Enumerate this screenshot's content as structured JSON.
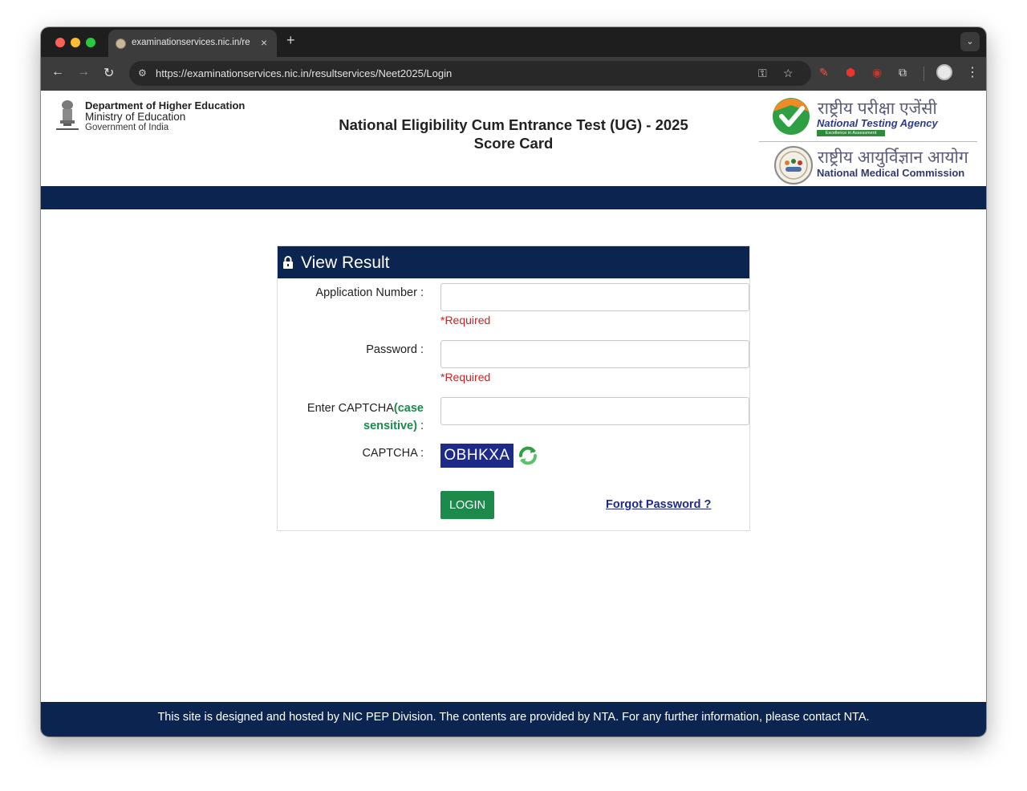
{
  "browser": {
    "tab_title": "examinationservices.nic.in/re",
    "tab_close": "×",
    "new_tab": "+",
    "url": "https://examinationservices.nic.in/resultservices/Neet2025/Login"
  },
  "header": {
    "dept": "Department of Higher Education",
    "ministry": "Ministry of Education",
    "govt": "Government of India",
    "title_line1": "National Eligibility Cum Entrance Test (UG) - 2025",
    "title_line2": "Score Card",
    "nta_hindi": "राष्ट्रीय परीक्षा एजेंसी",
    "nta_english": "National Testing Agency",
    "nta_tagline": "Excellence in Assessment",
    "nmc_hindi": "राष्ट्रीय आयुर्विज्ञान आयोग",
    "nmc_english": "National Medical Commission"
  },
  "form": {
    "heading": "View Result",
    "application_label": "Application Number :",
    "application_value": "",
    "password_label": "Password :",
    "password_value": "",
    "required_text": "*Required",
    "captcha_input_label_a": "Enter CAPTCHA",
    "captcha_input_label_b": "(case",
    "captcha_input_label_c": "sensitive)",
    "captcha_input_label_d": " :",
    "captcha_input_value": "",
    "captcha_label": "CAPTCHA :",
    "captcha_text": "OBHKXA",
    "login_label": "LOGIN",
    "forgot_label": "Forgot Password ?"
  },
  "footer": {
    "text": "This site is designed and hosted by NIC PEP Division. The contents are provided by NTA. For any further information, please contact NTA."
  },
  "colors": {
    "navy": "#0c2550",
    "green": "#1c8a4b",
    "required_red": "#cc2222",
    "link_blue": "#1f2a8a"
  }
}
